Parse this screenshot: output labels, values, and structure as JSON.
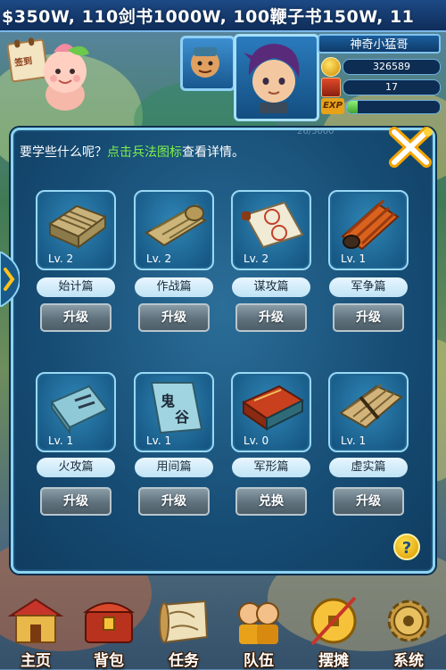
{
  "ticker": {
    "text": "$350W, 110剑书1000W, 100鞭子书150W, 11"
  },
  "calendar": {
    "text": "签到"
  },
  "player": {
    "name": "神奇小猛哥",
    "coins": "326589",
    "energy": "17",
    "exp_label": "EXP",
    "exp_fraction": 0.12
  },
  "panel": {
    "prompt_before": "要学些什么呢？",
    "prompt_highlight": "点击兵法图标",
    "prompt_after": "查看详情。",
    "background_number": "26/5000",
    "help": "?"
  },
  "skills": [
    {
      "name": "始计篇",
      "level": "Lv. 2",
      "action": "升级",
      "icon": "bamboo-scroll-icon"
    },
    {
      "name": "作战篇",
      "level": "Lv. 2",
      "action": "升级",
      "icon": "bamboo-roll-icon"
    },
    {
      "name": "谋攻篇",
      "level": "Lv. 2",
      "action": "升级",
      "icon": "paper-scroll-icon"
    },
    {
      "name": "军争篇",
      "level": "Lv. 1",
      "action": "升级",
      "icon": "red-scroll-icon"
    },
    {
      "name": "火攻篇",
      "level": "Lv. 1",
      "action": "升级",
      "icon": "blue-book-icon"
    },
    {
      "name": "用间篇",
      "level": "Lv. 1",
      "action": "升级",
      "icon": "ghost-book-icon"
    },
    {
      "name": "军形篇",
      "level": "Lv. 0",
      "action": "兑换",
      "icon": "red-book-icon"
    },
    {
      "name": "虚实篇",
      "level": "Lv. 1",
      "action": "升级",
      "icon": "tied-bamboo-icon"
    }
  ],
  "nav": [
    {
      "label": "主页",
      "icon": "palace-icon"
    },
    {
      "label": "背包",
      "icon": "chest-icon"
    },
    {
      "label": "任务",
      "icon": "map-scroll-icon"
    },
    {
      "label": "队伍",
      "icon": "team-icon"
    },
    {
      "label": "摆摊",
      "icon": "coin-stall-icon"
    },
    {
      "label": "系统",
      "icon": "gear-icon"
    }
  ],
  "colors": {
    "highlight": "#7ff04a",
    "panel_border": "#8cd4f2",
    "exp_fill": "#3ea52d"
  }
}
